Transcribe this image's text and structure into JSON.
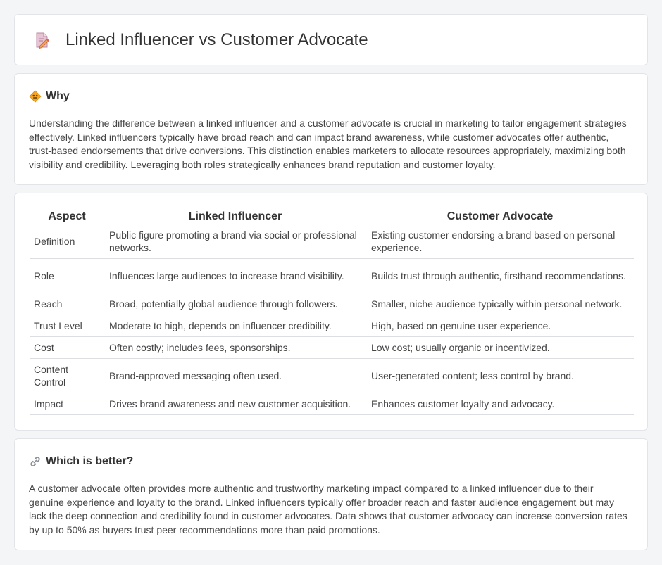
{
  "header": {
    "title": "Linked Influencer vs Customer Advocate"
  },
  "why": {
    "title": "Why",
    "text": "Understanding the difference between a linked influencer and a customer advocate is crucial in marketing to tailor engagement strategies effectively. Linked influencers typically have broad reach and can impact brand awareness, while customer advocates offer authentic, trust-based endorsements that drive conversions. This distinction enables marketers to allocate resources appropriately, maximizing both visibility and credibility. Leveraging both roles strategically enhances brand reputation and customer loyalty."
  },
  "table": {
    "headers": [
      "Aspect",
      "Linked Influencer",
      "Customer Advocate"
    ],
    "rows": [
      [
        "Definition",
        "Public figure promoting a brand via social or professional networks.",
        "Existing customer endorsing a brand based on personal experience."
      ],
      [
        "Role",
        "Influences large audiences to increase brand visibility.",
        "Builds trust through authentic, firsthand recommendations."
      ],
      [
        "Reach",
        "Broad, potentially global audience through followers.",
        "Smaller, niche audience typically within personal network."
      ],
      [
        "Trust Level",
        "Moderate to high, depends on influencer credibility.",
        "High, based on genuine user experience."
      ],
      [
        "Cost",
        "Often costly; includes fees, sponsorships.",
        "Low cost; usually organic or incentivized."
      ],
      [
        "Content Control",
        "Brand-approved messaging often used.",
        "User-generated content; less control by brand."
      ],
      [
        "Impact",
        "Drives brand awareness and new customer acquisition.",
        "Enhances customer loyalty and advocacy."
      ]
    ]
  },
  "better": {
    "title": "Which is better?",
    "text": "A customer advocate often provides more authentic and trustworthy marketing impact compared to a linked influencer due to their genuine experience and loyalty to the brand. Linked influencers typically offer broader reach and faster audience engagement but may lack the deep connection and credibility found in customer advocates. Data shows that customer advocacy can increase conversion rates by up to 50% as buyers trust peer recommendations more than paid promotions."
  },
  "icons": {
    "header": "document-edit-icon",
    "why": "warning-diamond-icon",
    "better": "link-icon"
  }
}
